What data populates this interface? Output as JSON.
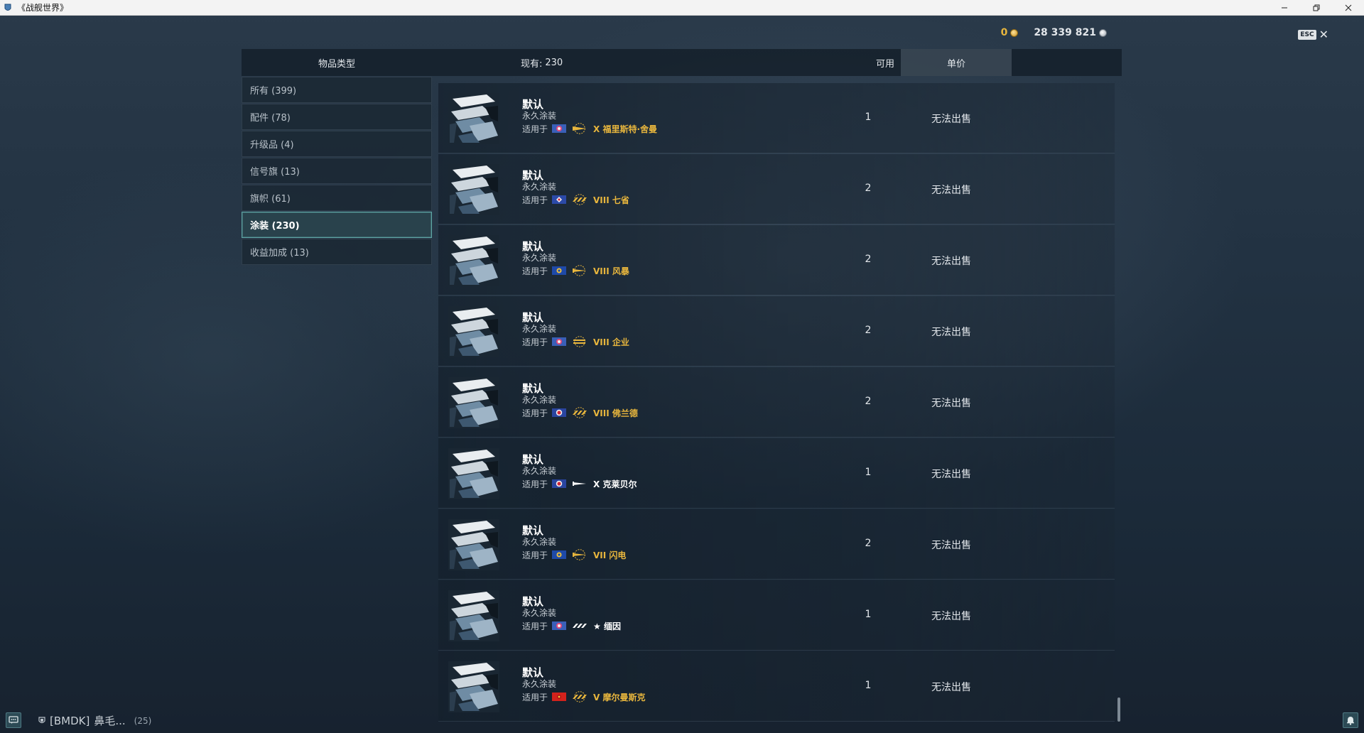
{
  "window": {
    "title": "《战舰世界》"
  },
  "currency": {
    "gold": "0",
    "silver": "28 339 821"
  },
  "esc": {
    "key": "ESC"
  },
  "header": {
    "item_type": "物品类型",
    "owned_label": "现有:",
    "owned_count": "230",
    "available": "可用",
    "unit_price": "单价"
  },
  "categories": [
    {
      "label": "所有 (399)",
      "active": false
    },
    {
      "label": "配件 (78)",
      "active": false
    },
    {
      "label": "升级品 (4)",
      "active": false
    },
    {
      "label": "信号旗 (13)",
      "active": false
    },
    {
      "label": "旗帜 (61)",
      "active": false
    },
    {
      "label": "涂装 (230)",
      "active": true
    },
    {
      "label": "收益加成 (13)",
      "active": false
    }
  ],
  "applies_label": "适用于",
  "items": [
    {
      "name": "默认",
      "type": "永久涂装",
      "nation": "flag-us",
      "ship_class": "battleship",
      "ship": "X 福里斯特·舍曼",
      "premium": true,
      "available": "1",
      "price": "无法出售"
    },
    {
      "name": "默认",
      "type": "永久涂装",
      "nation": "flag-uk",
      "ship_class": "destroyer",
      "ship": "VIII 七省",
      "premium": true,
      "available": "2",
      "price": "无法出售"
    },
    {
      "name": "默认",
      "type": "永久涂装",
      "nation": "flag-eu",
      "ship_class": "cruiser",
      "ship": "VIII 风暴",
      "premium": true,
      "available": "2",
      "price": "无法出售"
    },
    {
      "name": "默认",
      "type": "永久涂装",
      "nation": "flag-us",
      "ship_class": "carrier",
      "ship": "VIII 企业",
      "premium": true,
      "available": "2",
      "price": "无法出售"
    },
    {
      "name": "默认",
      "type": "永久涂装",
      "nation": "flag-fr",
      "ship_class": "destroyer",
      "ship": "VIII 佛兰德",
      "premium": true,
      "available": "2",
      "price": "无法出售"
    },
    {
      "name": "默认",
      "type": "永久涂装",
      "nation": "flag-fr",
      "ship_class": "cruiser",
      "ship": "X 克莱贝尔",
      "premium": false,
      "available": "1",
      "price": "无法出售"
    },
    {
      "name": "默认",
      "type": "永久涂装",
      "nation": "flag-eu",
      "ship_class": "cruiser",
      "ship": "VII 闪电",
      "premium": true,
      "available": "2",
      "price": "无法出售"
    },
    {
      "name": "默认",
      "type": "永久涂装",
      "nation": "flag-us",
      "ship_class": "destroyer",
      "ship": "★ 缅因",
      "premium": false,
      "available": "1",
      "price": "无法出售"
    },
    {
      "name": "默认",
      "type": "永久涂装",
      "nation": "flag-cn",
      "ship_class": "destroyer",
      "ship": "V 摩尔曼斯克",
      "premium": true,
      "available": "1",
      "price": "无法出售"
    }
  ],
  "bottom": {
    "clan_tag": "[BMDK]",
    "player": "鼻毛...",
    "count": "(25)"
  },
  "colors": {
    "accent": "#5fa5a5",
    "gold": "#e8b63d"
  }
}
